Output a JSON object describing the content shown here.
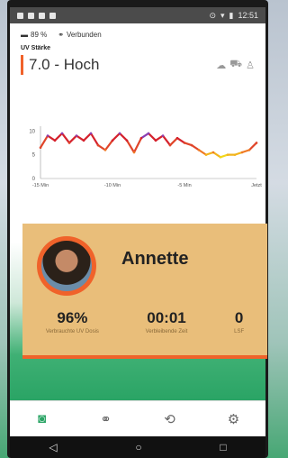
{
  "statusbar": {
    "time": "12:51"
  },
  "device": {
    "battery": "89 %",
    "connection": "Verbunden"
  },
  "uv": {
    "label": "UV Stärke",
    "value": "7.0 - Hoch"
  },
  "chart_data": {
    "type": "line",
    "xlabel": "",
    "ylabel": "",
    "x_ticks": [
      "-15 Min",
      "-10 Min",
      "-5 Min",
      "Jetzt"
    ],
    "y_ticks": [
      0,
      5,
      10
    ],
    "ylim": [
      0,
      11
    ],
    "xlim": [
      -15,
      0
    ],
    "x": [
      -15,
      -14.5,
      -14,
      -13.5,
      -13,
      -12.5,
      -12,
      -11.5,
      -11,
      -10.5,
      -10,
      -9.5,
      -9,
      -8.5,
      -8,
      -7.5,
      -7,
      -6.5,
      -6,
      -5.5,
      -5,
      -4.5,
      -4,
      -3.5,
      -3,
      -2.5,
      -2,
      -1.5,
      -1,
      -0.5,
      0
    ],
    "values": [
      6.5,
      9,
      8,
      9.5,
      7.5,
      9,
      8,
      9.5,
      7,
      6,
      8,
      9.5,
      8,
      5.5,
      8.5,
      9.5,
      8,
      9,
      7,
      8.5,
      7.5,
      7,
      6,
      5,
      5.5,
      4.5,
      5,
      5,
      5.5,
      6,
      7.5
    ]
  },
  "profile": {
    "name": "Annette",
    "stats": [
      {
        "value": "96%",
        "label": "Verbrauchte UV Dosis"
      },
      {
        "value": "00:01",
        "label": "Verbleibende Zeit"
      },
      {
        "value": "0",
        "label": "LSF"
      }
    ]
  },
  "tabs": [
    "sun-icon",
    "binoculars-icon",
    "history-icon",
    "settings-icon"
  ],
  "colors": {
    "accent": "#f0622a",
    "green": "#2aa465",
    "card": "#e9be7a"
  }
}
